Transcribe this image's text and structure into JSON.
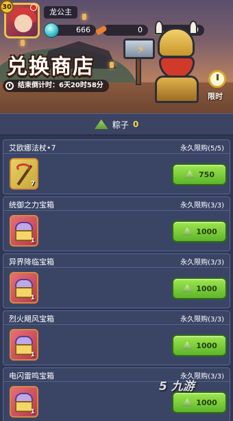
{
  "player": {
    "level": "30",
    "name": "龙公主"
  },
  "resources": [
    {
      "icon": "gem-icon",
      "value": "666"
    },
    {
      "icon": "carrot-icon",
      "value": "0"
    },
    {
      "icon": "zongzi-icon",
      "value": "0"
    }
  ],
  "shop": {
    "title": "兑换商店",
    "countdown": "结束倒计时：6天20时58分",
    "limited_label": "限时"
  },
  "currency": {
    "name": "粽子",
    "count": "0"
  },
  "items": [
    {
      "name": "艾欧娜法杖•7",
      "limit": "永久限购(5/5)",
      "qty": "7",
      "price": "750",
      "icon": "staff-icon"
    },
    {
      "name": "统御之力宝箱",
      "limit": "永久限购(3/3)",
      "qty": "1",
      "price": "1000",
      "icon": "chest-icon"
    },
    {
      "name": "异界降临宝箱",
      "limit": "永久限购(3/3)",
      "qty": "1",
      "price": "1000",
      "icon": "chest-icon"
    },
    {
      "name": "烈火飓风宝箱",
      "limit": "永久限购(3/3)",
      "qty": "1",
      "price": "1000",
      "icon": "chest-icon"
    },
    {
      "name": "电闪雷鸣宝箱",
      "limit": "永久限购(3/3)",
      "qty": "1",
      "price": "1000",
      "icon": "chest-icon"
    }
  ],
  "watermark": "5 九游",
  "colors": {
    "button_green": "#6fc23a",
    "panel": "#3a4566",
    "gold": "#f2d34a"
  }
}
